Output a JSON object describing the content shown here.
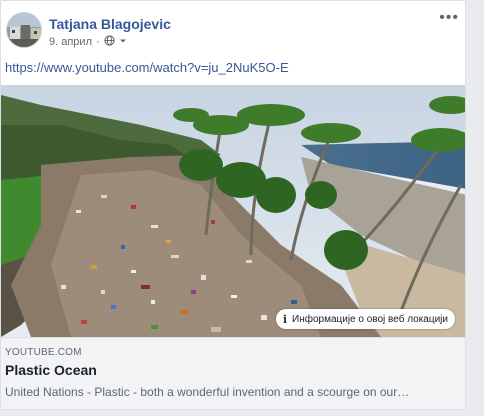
{
  "post": {
    "author": "Tatjana Blagojevic",
    "date": "9. април",
    "separator": "·",
    "more_label": "•••",
    "url_text": "https://www.youtube.com/watch?v=ju_2NuK5O-E",
    "privacy_icon": "globe-icon",
    "audience_icon": "chevron-down-icon"
  },
  "link_preview": {
    "info_label": "Информације о овој веб локацији",
    "info_icon": "info-icon",
    "domain": "YOUTUBE.COM",
    "title": "Plastic Ocean",
    "description": "United Nations - Plastic - both a wonderful invention and a scourge on our…"
  },
  "colors": {
    "author": "#365899",
    "link": "#385898",
    "preview_bg": "#f2f3f5",
    "page_bg": "#e9ebee"
  }
}
